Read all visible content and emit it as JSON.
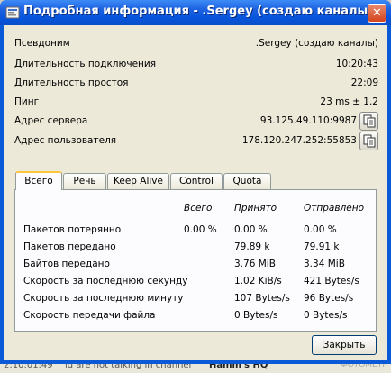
{
  "window": {
    "title": "Подробная информация - .Sergey (создаю каналы)",
    "close_glyph": "✕"
  },
  "info": [
    {
      "label": "Псевдоним",
      "value": ".Sergey (создаю каналы)",
      "copy": false
    },
    {
      "label": "Длительность подключения",
      "value": "10:20:43",
      "copy": false
    },
    {
      "label": "Длительность простоя",
      "value": "22:09",
      "copy": false
    },
    {
      "label": "Пинг",
      "value": "23 ms ± 1.2",
      "copy": false
    },
    {
      "label": "Адрес сервера",
      "value": "93.125.49.110:9987",
      "copy": true
    },
    {
      "label": "Адрес пользователя",
      "value": "178.120.247.252:55853",
      "copy": true
    }
  ],
  "tabs": [
    {
      "label": "Всего",
      "active": true
    },
    {
      "label": "Речь",
      "active": false
    },
    {
      "label": "Keep Alive",
      "active": false
    },
    {
      "label": "Control",
      "active": false
    },
    {
      "label": "Quota",
      "active": false
    }
  ],
  "stats": {
    "headers": [
      "Всего",
      "Принято",
      "Отправлено"
    ],
    "rows": [
      {
        "label": "Пакетов потерянно",
        "total": "0.00 %",
        "received": "0.00 %",
        "sent": "0.00 %"
      },
      {
        "label": "Пакетов передано",
        "total": "",
        "received": "79.89 k",
        "sent": "79.91 k"
      },
      {
        "label": "Байтов передано",
        "total": "",
        "received": "3.76 MiB",
        "sent": "3.34 MiB"
      },
      {
        "label": "Скорость за последнюю секунду",
        "total": "",
        "received": "1.02 KiB/s",
        "sent": "421 Bytes/s"
      },
      {
        "label": "Скорость за последнюю минуту",
        "total": "",
        "received": "107 Bytes/s",
        "sent": "96 Bytes/s"
      },
      {
        "label": "Скорость передачи файла",
        "total": "",
        "received": "0 Bytes/s",
        "sent": "0 Bytes/s"
      }
    ]
  },
  "buttons": {
    "close": "Закрыть"
  },
  "background": {
    "snippet1": "2:10:01:49",
    "snippet2": "ld are not talking in channel",
    "snippet3": "Hamm's HQ",
    "watermark": "ФОТОМЕТР"
  }
}
